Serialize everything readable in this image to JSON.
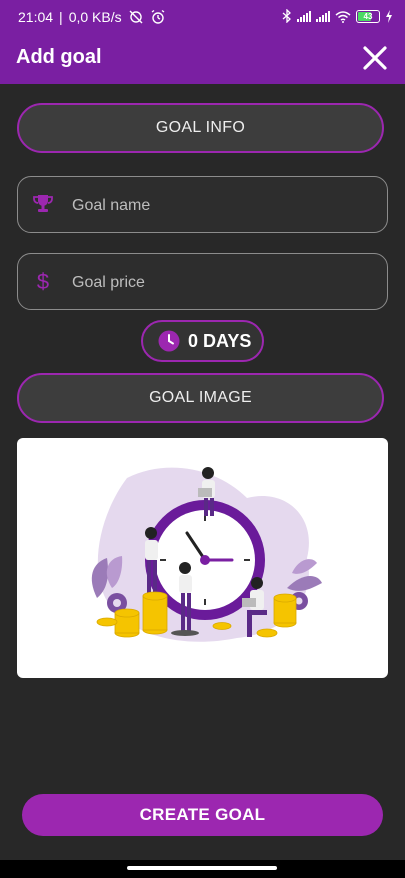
{
  "status_bar": {
    "time": "21:04",
    "network_speed": "0,0 KB/s",
    "battery_level": "43",
    "icons": [
      "alarm-off-icon",
      "alarm-icon",
      "bluetooth-icon",
      "signal-icon",
      "signal-icon",
      "wifi-icon",
      "battery-icon",
      "charging-icon"
    ]
  },
  "app_bar": {
    "title": "Add goal",
    "close_icon": "close-icon"
  },
  "form": {
    "goal_info_label": "GOAL INFO",
    "goal_name_placeholder": "Goal name",
    "goal_name_value": "",
    "goal_price_placeholder": "Goal price",
    "goal_price_value": "",
    "days_label": "0 DAYS",
    "goal_image_label": "GOAL IMAGE",
    "create_label": "CREATE GOAL"
  },
  "colors": {
    "primary": "#7a1fa2",
    "accent": "#9c27b0",
    "background": "#282828"
  }
}
